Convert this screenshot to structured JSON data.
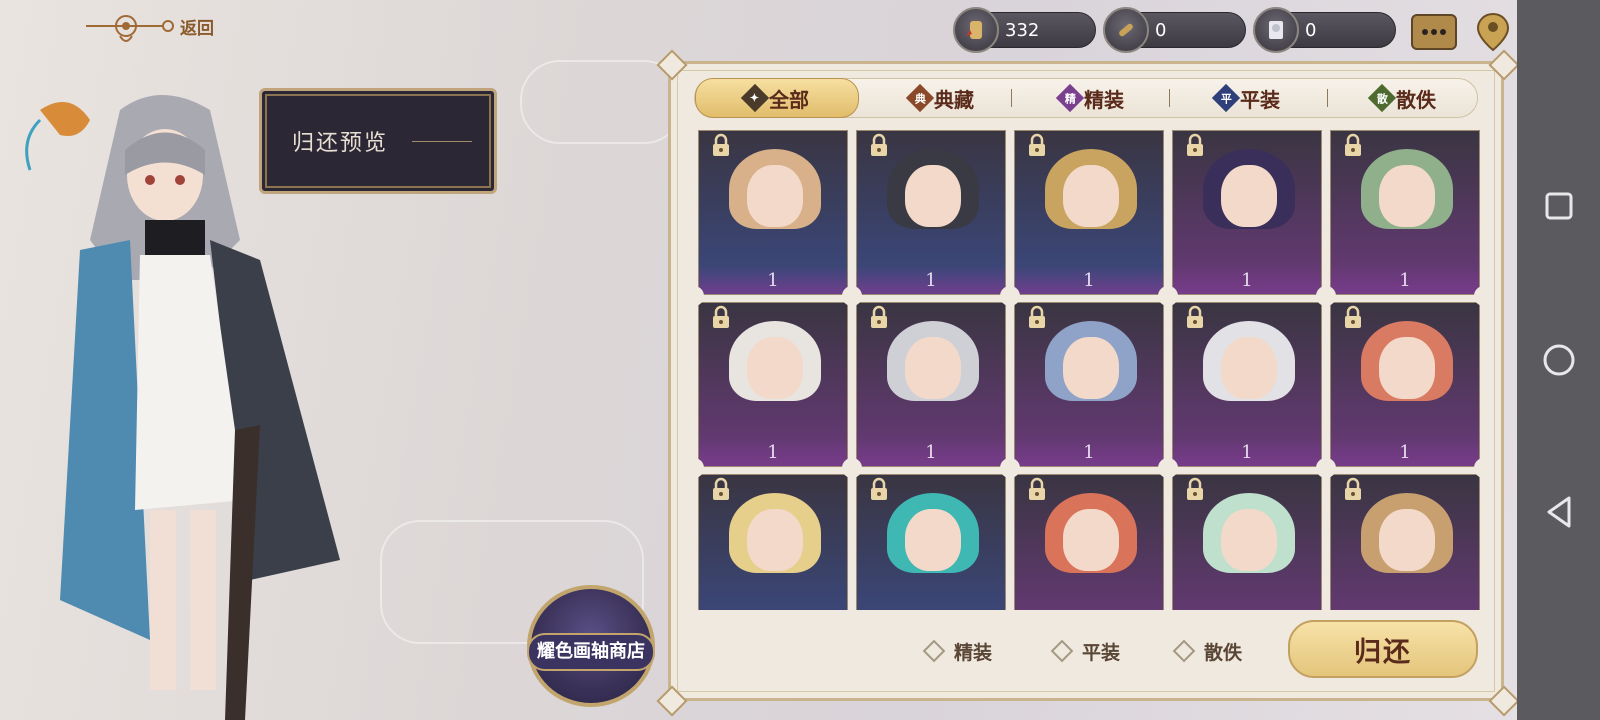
{
  "header": {
    "back_label": "返回",
    "currencies": [
      {
        "icon": "scroll-ticket-icon",
        "value": "332"
      },
      {
        "icon": "scroll-icon",
        "value": "0"
      },
      {
        "icon": "book-portrait-icon",
        "value": "0"
      }
    ]
  },
  "preview": {
    "label": "归还预览"
  },
  "shop": {
    "label": "耀色画轴商店"
  },
  "tabs": [
    {
      "label": "全部",
      "badge": "",
      "badge_color": "#4a3a2a",
      "active": true
    },
    {
      "label": "典藏",
      "badge": "典",
      "badge_color": "#8a4a2a",
      "active": false
    },
    {
      "label": "精装",
      "badge": "精",
      "badge_color": "#7a3f8f",
      "active": false
    },
    {
      "label": "平装",
      "badge": "平",
      "badge_color": "#2f3f7a",
      "active": false
    },
    {
      "label": "散佚",
      "badge": "散",
      "badge_color": "#4f6a2f",
      "active": false
    }
  ],
  "cards": [
    {
      "count": "1",
      "rarity": "blue",
      "hair": "#d8b08a"
    },
    {
      "count": "1",
      "rarity": "blue",
      "hair": "#3a3a44"
    },
    {
      "count": "1",
      "rarity": "blue",
      "hair": "#c9a460"
    },
    {
      "count": "1",
      "rarity": "purple",
      "hair": "#3a2f5a"
    },
    {
      "count": "1",
      "rarity": "purple",
      "hair": "#8fb08a"
    },
    {
      "count": "1",
      "rarity": "purple",
      "hair": "#e8e4e0"
    },
    {
      "count": "1",
      "rarity": "purple",
      "hair": "#cfcfd6"
    },
    {
      "count": "1",
      "rarity": "purple",
      "hair": "#8fa2c8"
    },
    {
      "count": "1",
      "rarity": "purple",
      "hair": "#e2e2e6"
    },
    {
      "count": "1",
      "rarity": "purple",
      "hair": "#d97a62"
    },
    {
      "count": "",
      "rarity": "blue",
      "hair": "#e6cf8a"
    },
    {
      "count": "",
      "rarity": "blue",
      "hair": "#3fb7b2"
    },
    {
      "count": "",
      "rarity": "purple",
      "hair": "#d9735a"
    },
    {
      "count": "",
      "rarity": "purple",
      "hair": "#bfe0cc"
    },
    {
      "count": "",
      "rarity": "purple",
      "hair": "#c8a070"
    }
  ],
  "filters": [
    {
      "label": "精装"
    },
    {
      "label": "平装"
    },
    {
      "label": "散佚"
    }
  ],
  "return_button": {
    "label": "归还"
  },
  "colors": {
    "rarity_blue": "#3b4a82",
    "rarity_purple": "#6a3a7a",
    "gold": "#e1bd6b"
  }
}
